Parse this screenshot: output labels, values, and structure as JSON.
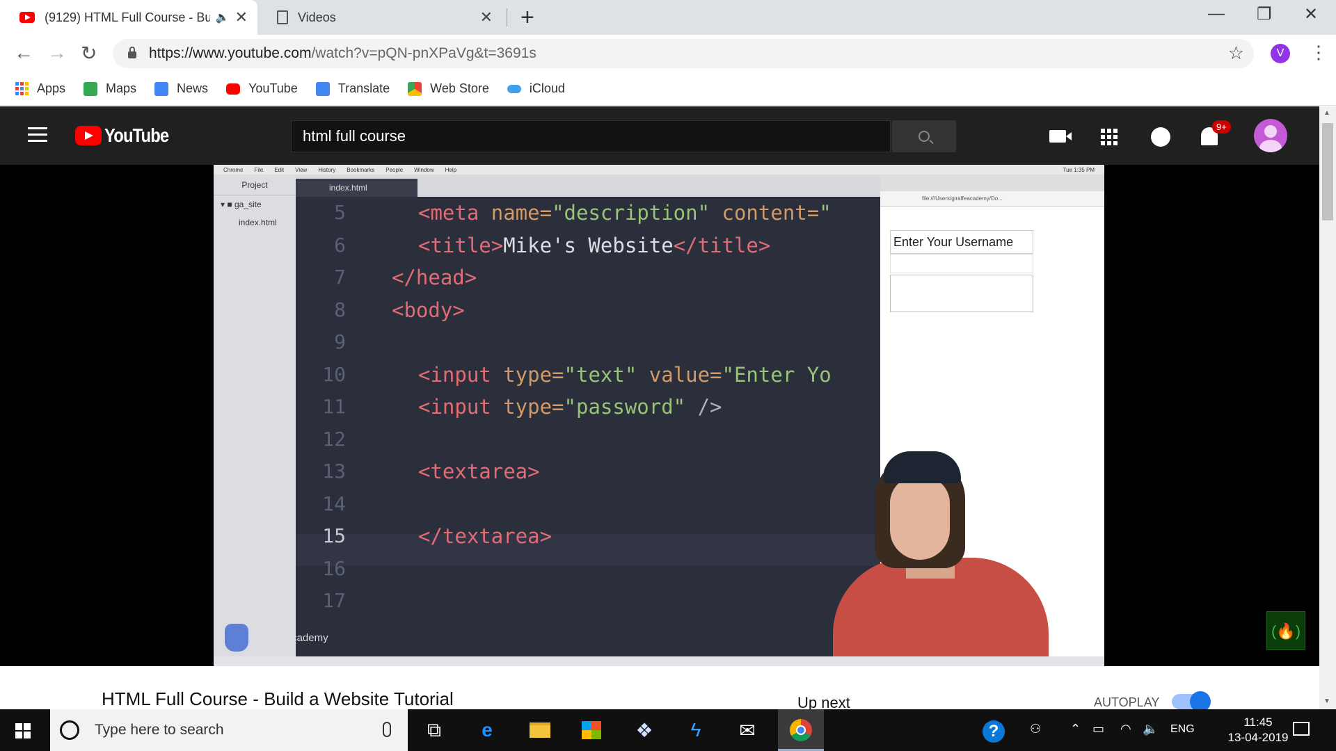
{
  "browser": {
    "tabs": [
      {
        "title": "(9129) HTML Full Course - Bu",
        "icon": "youtube-favicon",
        "audio": "🔈",
        "close": "✕"
      },
      {
        "title": "Videos",
        "icon": "page-icon",
        "close": "✕"
      }
    ],
    "new_tab": "+",
    "window_controls": {
      "minimize": "—",
      "maximize": "❐",
      "close": "✕"
    },
    "nav": {
      "back": "←",
      "forward": "→",
      "reload": "↻"
    },
    "url_host": "https://www.youtube.com",
    "url_path": "/watch?v=pQN-pnXPaVg&t=3691s",
    "star": "☆",
    "profile_letter": "V",
    "menu": "⋮",
    "bookmarks": [
      "Apps",
      "Maps",
      "News",
      "YouTube",
      "Translate",
      "Web Store",
      "iCloud"
    ],
    "bookmark_colors": [
      "#4285f4",
      "#34a853",
      "#4285f4",
      "#ff0000",
      "#4285f4",
      "#ea4335",
      "#3ea1ec"
    ]
  },
  "youtube": {
    "logo_text": "YouTube",
    "search_value": "html full course",
    "notification_count": "9+",
    "accent": "#ff0000"
  },
  "video_frame": {
    "menubar": [
      "Chrome",
      "File",
      "Edit",
      "View",
      "History",
      "Bookmarks",
      "People",
      "Window",
      "Help"
    ],
    "clock": "Tue 1:35 PM",
    "project_header": "Project",
    "project_items": [
      "▾ ■ ga_site",
      "index.html"
    ],
    "editor_tab": "index.html",
    "code_lines": [
      {
        "n": "5",
        "code": [
          [
            "tag",
            "<meta "
          ],
          [
            "attr",
            "name="
          ],
          [
            "str",
            "\"description\" "
          ],
          [
            "attr",
            "content="
          ],
          [
            "str",
            "\""
          ]
        ],
        "indent": 2
      },
      {
        "n": "6",
        "code": [
          [
            "tag",
            "<title>"
          ],
          [
            "txt",
            "Mike's Website"
          ],
          [
            "tag",
            "</title>"
          ]
        ],
        "indent": 2
      },
      {
        "n": "7",
        "code": [
          [
            "tag",
            "</head>"
          ]
        ],
        "indent": 1
      },
      {
        "n": "8",
        "code": [
          [
            "tag",
            "<body>"
          ]
        ],
        "indent": 1
      },
      {
        "n": "9",
        "code": [],
        "indent": 0
      },
      {
        "n": "10",
        "code": [
          [
            "tag",
            "<input "
          ],
          [
            "attr",
            "type="
          ],
          [
            "str",
            "\"text\" "
          ],
          [
            "attr",
            "value="
          ],
          [
            "str",
            "\"Enter Yo"
          ]
        ],
        "indent": 2
      },
      {
        "n": "11",
        "code": [
          [
            "tag",
            "<input "
          ],
          [
            "attr",
            "type="
          ],
          [
            "str",
            "\"password\" "
          ],
          [
            "pun",
            "/>"
          ]
        ],
        "indent": 2
      },
      {
        "n": "12",
        "code": [],
        "indent": 0
      },
      {
        "n": "13",
        "code": [
          [
            "tag",
            "<textarea>"
          ]
        ],
        "indent": 2
      },
      {
        "n": "14",
        "code": [],
        "indent": 0
      },
      {
        "n": "15",
        "code": [
          [
            "tag",
            "</textarea>"
          ]
        ],
        "indent": 2
      },
      {
        "n": "16",
        "code": [],
        "indent": 0
      },
      {
        "n": "17",
        "code": [],
        "indent": 0
      }
    ],
    "preview_url": "file:///Users/giraffeacademy/Do...",
    "preview_input_value": "Enter Your Username",
    "watermark": "Giraffe Academy",
    "channel_badge": "(🔥)"
  },
  "below_player": {
    "title": "HTML Full Course - Build a Website Tutorial",
    "up_next": "Up next",
    "autoplay": "AUTOPLAY"
  },
  "taskbar": {
    "search_placeholder": "Type here to search",
    "language": "ENG",
    "time": "11:45",
    "date": "13-04-2019",
    "help": "?"
  }
}
